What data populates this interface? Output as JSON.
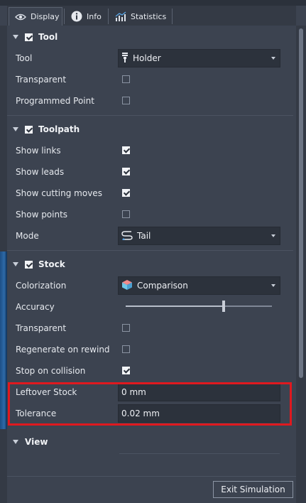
{
  "tabs": [
    {
      "label": "Display",
      "icon": "eye-icon"
    },
    {
      "label": "Info",
      "icon": "info-icon"
    },
    {
      "label": "Statistics",
      "icon": "statistics-icon"
    }
  ],
  "tool_section": {
    "title": "Tool",
    "tool_label": "Tool",
    "tool_value": "Holder",
    "transparent_label": "Transparent",
    "programmed_point_label": "Programmed Point"
  },
  "toolpath_section": {
    "title": "Toolpath",
    "show_links_label": "Show links",
    "show_leads_label": "Show leads",
    "show_cutting_moves_label": "Show cutting moves",
    "show_points_label": "Show points",
    "mode_label": "Mode",
    "mode_value": "Tail"
  },
  "stock_section": {
    "title": "Stock",
    "colorization_label": "Colorization",
    "colorization_value": "Comparison",
    "accuracy_label": "Accuracy",
    "accuracy_level": 0.67,
    "transparent_label": "Transparent",
    "regenerate_label": "Regenerate on rewind",
    "stop_on_collision_label": "Stop on collision",
    "leftover_stock_label": "Leftover Stock",
    "leftover_stock_value": "0 mm",
    "tolerance_label": "Tolerance",
    "tolerance_value": "0.02 mm"
  },
  "view_section": {
    "title": "View"
  },
  "footer": {
    "exit_button_label": "Exit Simulation"
  },
  "colors": {
    "panel_bg": "#3c4350",
    "input_bg": "#2c323c",
    "highlight": "#e0191f"
  }
}
